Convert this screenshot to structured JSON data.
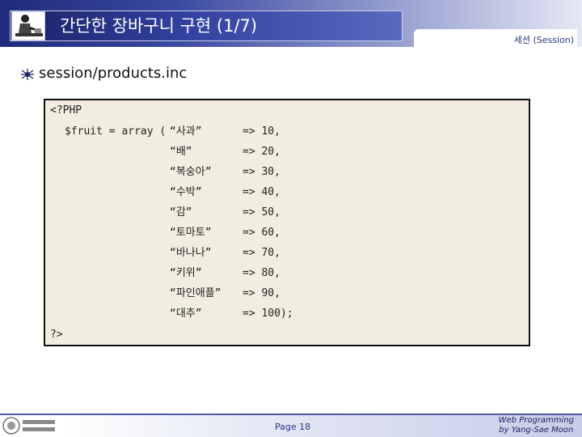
{
  "header": {
    "title": "간단한 장바구니 구현 (1/7)",
    "section": "세션 (Session)"
  },
  "heading": {
    "filename": "session/products.inc"
  },
  "code": {
    "open_tag": "<?PHP",
    "prefix": "$fruit = array (",
    "entries": [
      {
        "key": "“사과”",
        "value": "=> 10,"
      },
      {
        "key": "“배”",
        "value": "=> 20,"
      },
      {
        "key": "“복숭아”",
        "value": "=> 30,"
      },
      {
        "key": "“수박”",
        "value": "=> 40,"
      },
      {
        "key": "“감”",
        "value": "=> 50,"
      },
      {
        "key": "“토마토”",
        "value": "=> 60,"
      },
      {
        "key": "“바나나”",
        "value": "=> 70,"
      },
      {
        "key": "“키위”",
        "value": "=> 80,"
      },
      {
        "key": "“파인애플”",
        "value": "=> 90,"
      },
      {
        "key": "“대추”",
        "value": "=> 100);"
      }
    ],
    "close_tag": "?>"
  },
  "footer": {
    "page": "Page 18",
    "credit_line1": "Web Programming",
    "credit_line2": "by Yang-Sae Moon"
  },
  "colors": {
    "header_dark": "#1f2a7a",
    "accent": "#2a3680",
    "code_bg": "#f2eedf"
  }
}
